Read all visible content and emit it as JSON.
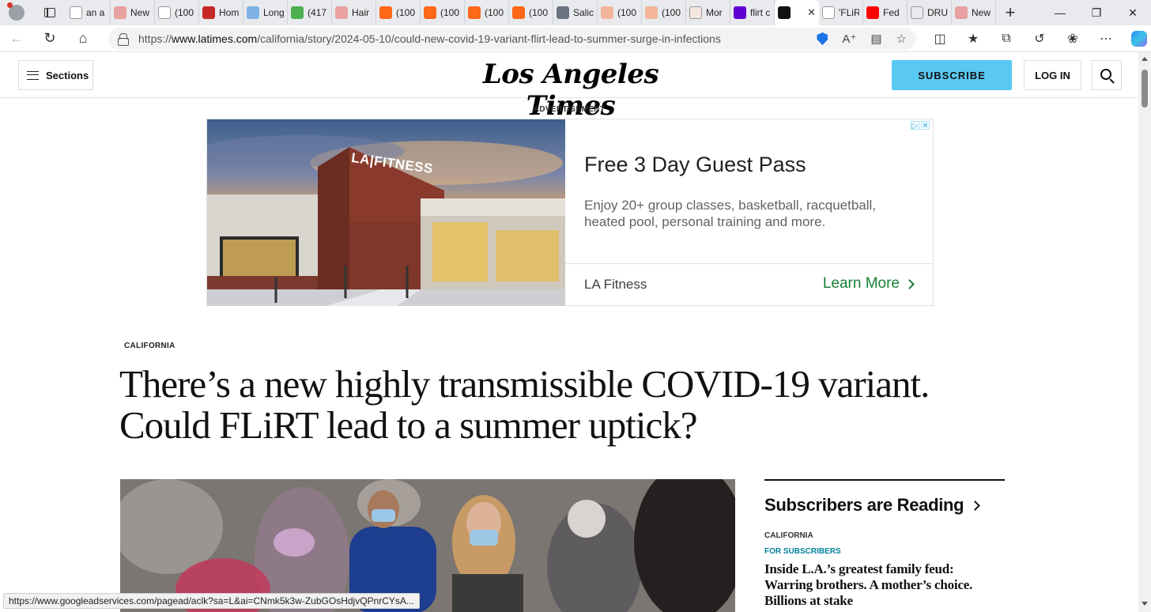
{
  "browser": {
    "tabs": [
      {
        "label": "an a",
        "icon": "document-icon",
        "color": "#ffffff"
      },
      {
        "label": "New",
        "icon": "tribune-icon",
        "color": "#e8a0a0"
      },
      {
        "label": "(100",
        "icon": "document-icon",
        "color": "#ffffff"
      },
      {
        "label": "Hom",
        "icon": "red-shield-icon",
        "color": "#c62828"
      },
      {
        "label": "Long",
        "icon": "five-icon",
        "color": "#7fb2e5"
      },
      {
        "label": "(417",
        "icon": "g-icon",
        "color": "#4caf50"
      },
      {
        "label": "Hair",
        "icon": "patreon-icon",
        "color": "#e8a0a0"
      },
      {
        "label": "(100",
        "icon": "substack-icon",
        "color": "#ff6719"
      },
      {
        "label": "(100",
        "icon": "substack-icon",
        "color": "#ff6719"
      },
      {
        "label": "(100",
        "icon": "substack-icon",
        "color": "#ff6719"
      },
      {
        "label": "(100",
        "icon": "substack-icon",
        "color": "#ff6719"
      },
      {
        "label": "Salic",
        "icon": "c-icon",
        "color": "#6b7280"
      },
      {
        "label": "(100",
        "icon": "substack-icon",
        "color": "#f2b59a"
      },
      {
        "label": "(100",
        "icon": "substack-icon",
        "color": "#f2b59a"
      },
      {
        "label": "Mor",
        "icon": "bi-icon",
        "color": "#f5e6df"
      },
      {
        "label": "flirt c",
        "icon": "yahoo-icon",
        "color": "#5f01d1"
      },
      {
        "label": "",
        "icon": "latimes-icon",
        "color": "#111111",
        "active": true
      },
      {
        "label": "'FLiR",
        "icon": "dots-icon",
        "color": "#ffffff"
      },
      {
        "label": "Fed",
        "icon": "youtube-icon",
        "color": "#ff0000"
      },
      {
        "label": "DRU",
        "icon": "drudge-icon",
        "color": "#e8eaed"
      },
      {
        "label": "New",
        "icon": "tribune-icon",
        "color": "#e8a0a0"
      }
    ],
    "url_prefix": "https://",
    "url_host": "www.latimes.com",
    "url_path": "/california/story/2024-05-10/could-new-covid-19-variant-flirt-lead-to-summer-surge-in-infections",
    "status_url": "https://www.googleadservices.com/pagead/aclk?sa=L&ai=CNmk5k3w-ZubGOsHdjvQPnrCYsA..."
  },
  "header": {
    "sections_label": "Sections",
    "logo_text": "Los Angeles Times",
    "subscribe_label": "SUBSCRIBE",
    "login_label": "LOG IN"
  },
  "ad": {
    "label": "ADVERTISEMENT",
    "sign_text": "LA|FITNESS",
    "headline": "Free 3 Day Guest Pass",
    "body": "Enjoy 20+ group classes, basketball, racquetball, heated pool, personal training and more.",
    "brand": "LA Fitness",
    "cta": "Learn More"
  },
  "article": {
    "section": "CALIFORNIA",
    "headline": "There’s a new highly transmissible COVID-19 variant. Could FLiRT lead to a summer uptick?"
  },
  "sidebar": {
    "title": "Subscribers are Reading",
    "items": [
      {
        "section": "CALIFORNIA",
        "badge": "FOR SUBSCRIBERS",
        "headline": "Inside L.A.’s greatest family feud: Warring brothers. A mother’s choice. Billions at stake"
      }
    ]
  },
  "colors": {
    "subscribe": "#59c8f3",
    "cta_green": "#188038",
    "badge_teal": "#00809d"
  }
}
